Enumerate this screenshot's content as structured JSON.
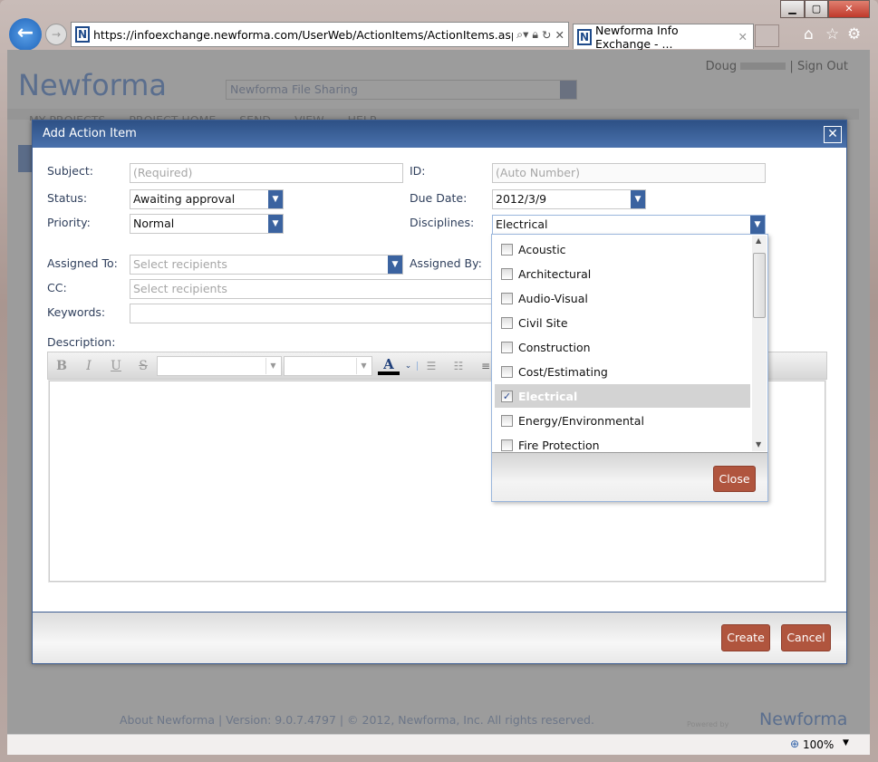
{
  "browser": {
    "url": "https://infoexchange.newforma.com/UserWeb/ActionItems/ActionItems.aspx?pid=",
    "tab_title": "Newforma Info Exchange - ...",
    "zoom": "100%"
  },
  "site": {
    "logo": "Newforma",
    "project_select": "Newforma File Sharing",
    "user": "Doug",
    "sign_out": "Sign Out",
    "nav": [
      "MY PROJECTS",
      "PROJECT HOME",
      "SEND",
      "VIEW",
      "HELP"
    ],
    "footer": "About Newforma | Version: 9.0.7.4797 | © 2012, Newforma, Inc. All rights reserved.",
    "powered_by": "Powered by"
  },
  "dialog": {
    "title": "Add Action Item",
    "subject_label": "Subject:",
    "subject_placeholder": "(Required)",
    "id_label": "ID:",
    "id_placeholder": "(Auto Number)",
    "status_label": "Status:",
    "status_value": "Awaiting approval",
    "due_label": "Due Date:",
    "due_value": "2012/3/9",
    "priority_label": "Priority:",
    "priority_value": "Normal",
    "disciplines_label": "Disciplines:",
    "disciplines_value": "Electrical",
    "assigned_to_label": "Assigned To:",
    "assigned_to_placeholder": "Select recipients",
    "assigned_by_label": "Assigned By:",
    "cc_label": "CC:",
    "cc_placeholder": "Select recipients",
    "keywords_label": "Keywords:",
    "description_label": "Description:",
    "toolbar": {
      "bold": "B",
      "italic": "I",
      "underline": "U",
      "strike": "S",
      "font_color": "A"
    },
    "create": "Create",
    "cancel": "Cancel"
  },
  "disciplines_list": {
    "options": [
      {
        "label": "Acoustic",
        "checked": false
      },
      {
        "label": "Architectural",
        "checked": false
      },
      {
        "label": "Audio-Visual",
        "checked": false
      },
      {
        "label": "Civil Site",
        "checked": false
      },
      {
        "label": "Construction",
        "checked": false
      },
      {
        "label": "Cost/Estimating",
        "checked": false
      },
      {
        "label": "Electrical",
        "checked": true
      },
      {
        "label": "Energy/Environmental",
        "checked": false
      },
      {
        "label": "Fire Protection",
        "checked": false
      }
    ],
    "close": "Close"
  }
}
